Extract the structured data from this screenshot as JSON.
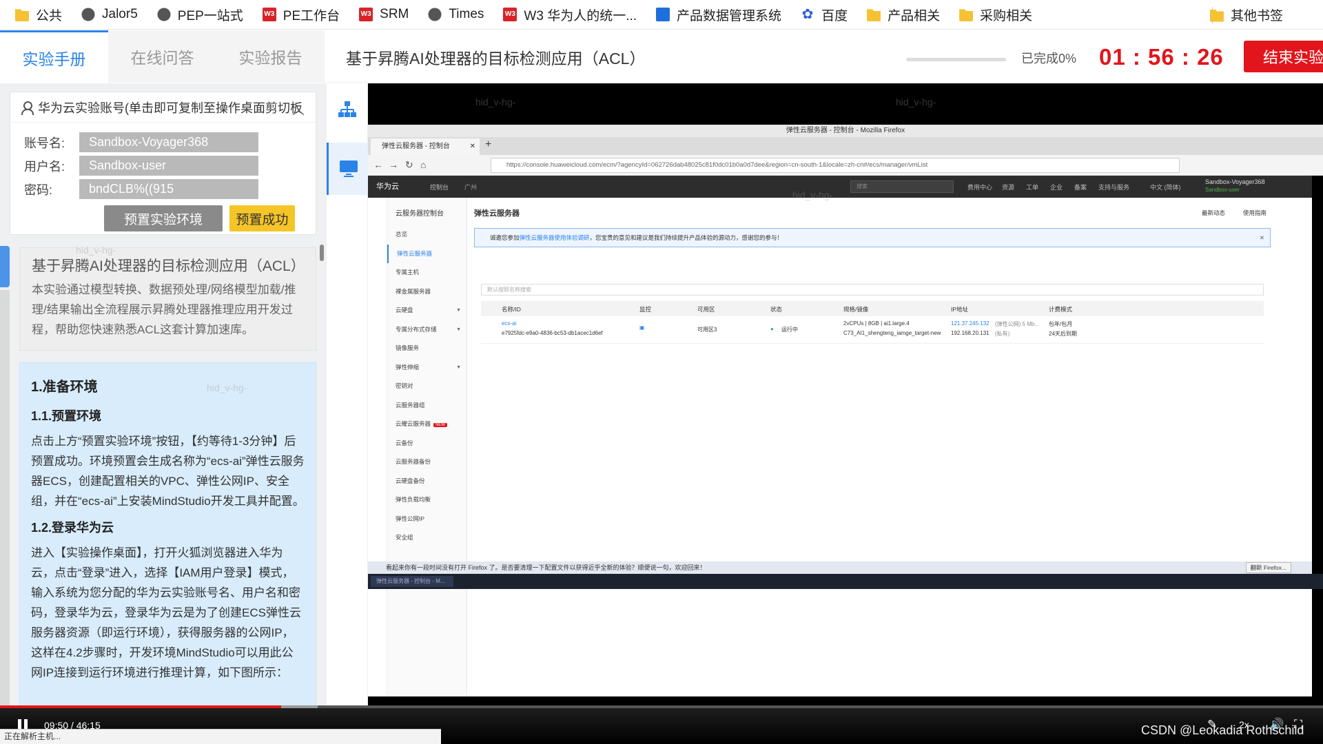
{
  "bookmarks": [
    {
      "label": "公共",
      "icon": "folder-icon"
    },
    {
      "label": "Jalor5",
      "icon": "globe-icon"
    },
    {
      "label": "PEP一站式",
      "icon": "globe-icon"
    },
    {
      "label": "PE工作台",
      "icon": "w3-icon"
    },
    {
      "label": "SRM",
      "icon": "w3-icon"
    },
    {
      "label": "Times",
      "icon": "globe-icon"
    },
    {
      "label": "W3 华为人的统一...",
      "icon": "w3-icon"
    },
    {
      "label": "产品数据管理系统",
      "icon": "doc-icon"
    },
    {
      "label": "百度",
      "icon": "paw-icon"
    },
    {
      "label": "产品相关",
      "icon": "folder-icon"
    },
    {
      "label": "采购相关",
      "icon": "folder-icon"
    }
  ],
  "other_bookmarks": "其他书签",
  "tabs": [
    "实验手册",
    "在线问答",
    "实验报告"
  ],
  "lab_title": "基于昇腾AI处理器的目标检测应用（ACL）",
  "progress": {
    "fraction": 0.0,
    "text": "已完成0%"
  },
  "timer": "01 : 56 : 26",
  "end_button": "结束实验",
  "account": {
    "header": "华为云实验账号(单击即可复制至操作桌面剪切板",
    "rows": [
      {
        "label": "账号名:",
        "value": "Sandbox-Voyager368"
      },
      {
        "label": "用户名:",
        "value": "Sandbox-user"
      },
      {
        "label": "密码:",
        "value": "bndCLB%((915"
      }
    ],
    "preset_button": "预置实验环境",
    "preset_status": "预置成功"
  },
  "intro": {
    "title": "基于昇腾AI处理器的目标检测应用（ACL）",
    "desc": "本实验通过模型转换、数据预处理/网络模型加载/推理/结果输出全流程展示昇腾处理器推理应用开发过程，帮助您快速熟悉ACL这套计算加速库。"
  },
  "manual": {
    "h1": "1.准备环境",
    "s1_title": "1.1.预置环境",
    "s1_body": "点击上方“预置实验环境”按钮，【约等待1-3分钟】后预置成功。环境预置会生成名称为“ecs-ai”弹性云服务器ECS，创建配置相关的VPC、弹性公网IP、安全组，并在“ecs-ai”上安装MindStudio开发工具并配置。",
    "s2_title": "1.2.登录华为云",
    "s2_body": "进入【实验操作桌面】，打开火狐浏览器进入华为云，点击“登录”进入，选择【IAM用户登录】模式，输入系统为您分配的华为云实验账号名、用户名和密码，登录华为云，登录华为云是为了创建ECS弹性云服务器资源（即运行环境），获得服务器的公网IP，这样在4.2步骤时，开发环境MindStudio可以用此公网IP连接到运行环境进行推理计算，如下图所示："
  },
  "remote": {
    "window_title": "弹性云服务器 - 控制台 - Mozilla Firefox",
    "tab_title": "弹性云服务器 - 控制台",
    "url": "https://console.huaweicloud.com/ecm/?agencyId=062726dab48025c81f0dc01b0a0d7dee&region=cn-south-1&locale=zh-cn#/ecs/manager/vmList",
    "hw_logo": "华为云",
    "hw_console": "控制台",
    "hw_region": "广州",
    "hw_search": "搜索",
    "hw_menus": [
      "费用中心",
      "资源",
      "工单",
      "企业",
      "备案",
      "支持与服务",
      "中文 (简体)"
    ],
    "hw_user": "Sandbox-Voyager368",
    "hw_user_sub": "Sandbox-user",
    "sidebar_head": "云服务器控制台",
    "sidebar_items": [
      "总览",
      "弹性云服务器",
      "专属主机",
      "裸金属服务器",
      "云硬盘",
      "专属分布式存储",
      "镜像服务",
      "弹性伸缩",
      "密钥对",
      "云服务器组",
      "云耀云服务器",
      "云备份",
      "云服务器备份",
      "云硬盘备份",
      "弹性负载均衡",
      "弹性公网IP",
      "安全组"
    ],
    "new_badge": "NEW",
    "page_title": "弹性云服务器",
    "latest": "最新动态",
    "guide": "使用指南",
    "notice_prefix": "诚邀您参加",
    "notice_link": "弹性云服务器使用体验调研",
    "notice_suffix": "，您宝贵的意见和建议是我们持续提升产品体验的源动力，感谢您的参与！",
    "filter_placeholder": "默认按照名称搜索",
    "columns": [
      "名称/ID",
      "监控",
      "可用区",
      "状态",
      "规格/镜像",
      "IP地址",
      "计费模式"
    ],
    "row": {
      "name": "ecs-ai",
      "id": "e7925fdc-e9a0-4836-bc53-db1acec1d6ef",
      "zone": "可用区3",
      "status": "运行中",
      "spec": "2vCPUs | 8GB | ai1.large.4",
      "image": "C73_AI1_shengteng_iamge_target-new",
      "ip_public": "121.37.245.132",
      "ip_public_tag": "(弹性公网) 5 Mb...",
      "ip_private": "192.168.20.131",
      "ip_private_tag": "(私有)",
      "billing": "包年/包月",
      "billing_due": "24天后到期"
    },
    "ff_notice": "看起来你有一段时间没有打开 Firefox 了。是否要清理一下配置文件以获得近乎全新的体验？顺便说一句，欢迎回来！",
    "ff_notice_btn": "翻新 Firefox...",
    "taskbar_item": "弹性云服务器 - 控制台 - M..."
  },
  "video": {
    "current": "09:50",
    "total": "46:15",
    "played_fraction": 0.2127,
    "speed": "2x"
  },
  "status_strip": "正在解析主机...",
  "watermark": "CSDN @Leokadia Rothschild",
  "overlay_watermark": "hid_v-hg-",
  "colors": {
    "accent": "#2b83e8",
    "danger": "#e1151b",
    "warn": "#f5c426"
  }
}
